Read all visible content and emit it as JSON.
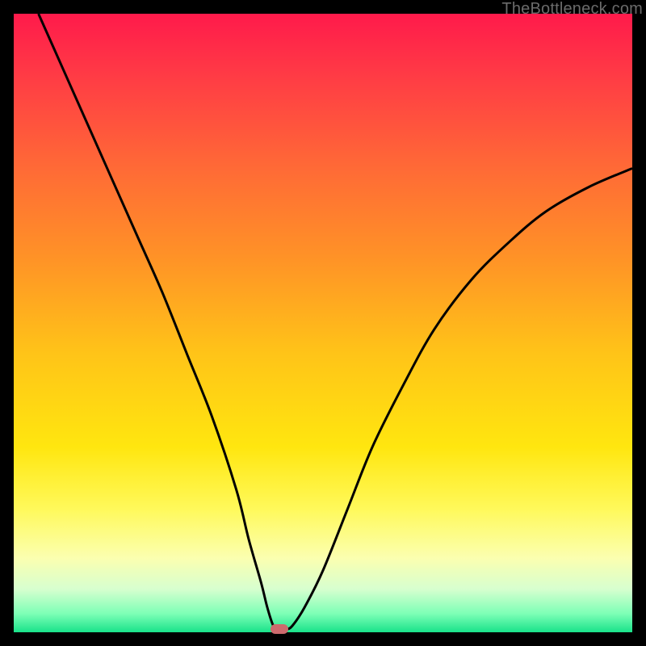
{
  "watermark": "TheBottleneck.com",
  "chart_data": {
    "type": "line",
    "title": "",
    "xlabel": "",
    "ylabel": "",
    "xlim": [
      0,
      100
    ],
    "ylim": [
      0,
      100
    ],
    "background_gradient": {
      "stops": [
        {
          "offset": 0.0,
          "color": "#ff1a4b"
        },
        {
          "offset": 0.1,
          "color": "#ff3b45"
        },
        {
          "offset": 0.25,
          "color": "#ff6a36"
        },
        {
          "offset": 0.4,
          "color": "#ff9426"
        },
        {
          "offset": 0.55,
          "color": "#ffc418"
        },
        {
          "offset": 0.7,
          "color": "#ffe60f"
        },
        {
          "offset": 0.8,
          "color": "#fff95a"
        },
        {
          "offset": 0.88,
          "color": "#fbffb0"
        },
        {
          "offset": 0.93,
          "color": "#d7ffcf"
        },
        {
          "offset": 0.97,
          "color": "#7dffb6"
        },
        {
          "offset": 1.0,
          "color": "#19e28a"
        }
      ]
    },
    "series": [
      {
        "name": "bottleneck-curve",
        "color": "#000000",
        "x": [
          4,
          8,
          12,
          16,
          20,
          24,
          28,
          32,
          36,
          38,
          40,
          41,
          42,
          43,
          44,
          45,
          47,
          50,
          54,
          58,
          63,
          68,
          74,
          80,
          86,
          93,
          100
        ],
        "y": [
          100,
          91,
          82,
          73,
          64,
          55,
          45,
          35,
          23,
          15,
          8,
          4,
          1,
          0.5,
          0.5,
          1,
          4,
          10,
          20,
          30,
          40,
          49,
          57,
          63,
          68,
          72,
          75
        ]
      }
    ],
    "marker": {
      "name": "optimal-point",
      "x": 43,
      "y": 0.5,
      "color": "#cd6a6d"
    }
  }
}
